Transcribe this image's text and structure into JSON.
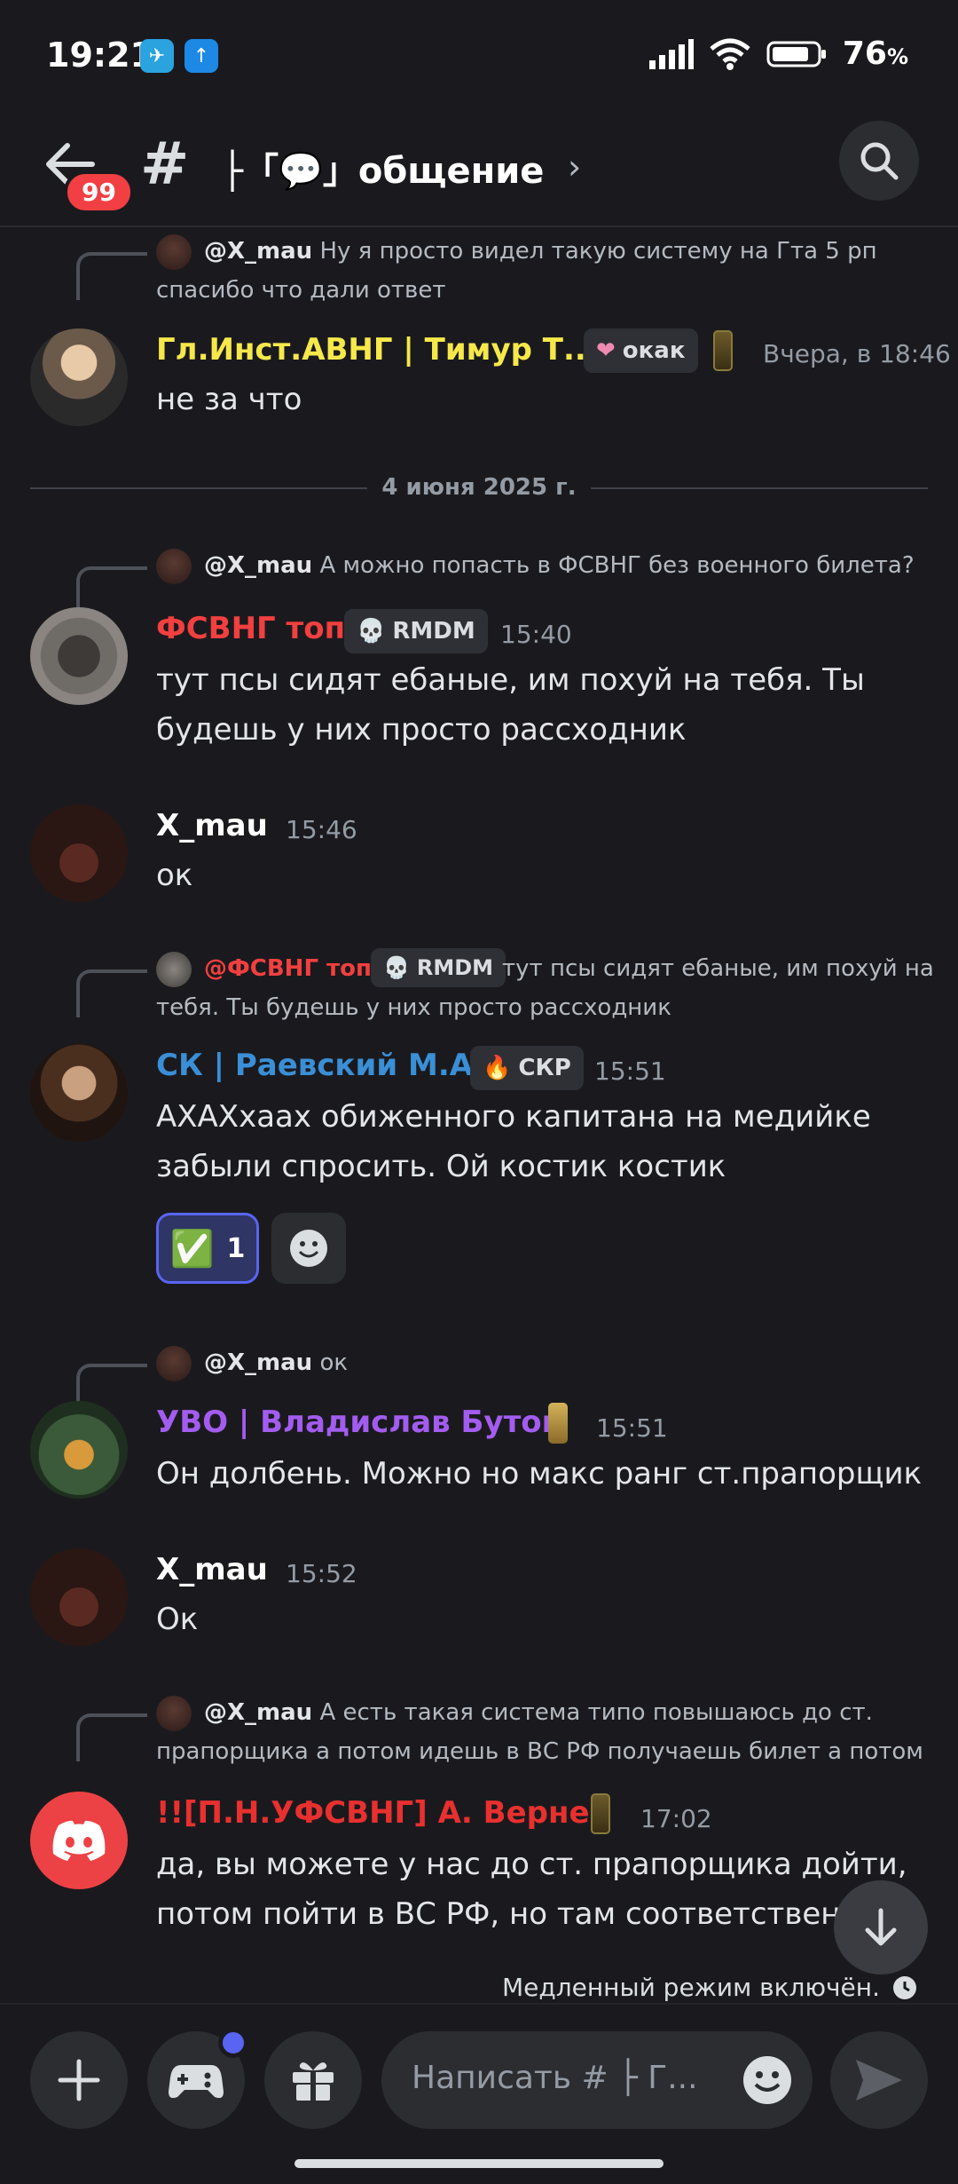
{
  "status_bar": {
    "time": "19:21",
    "battery_pct": "76",
    "battery_unit": "%"
  },
  "header": {
    "badge": "99",
    "channel_name": "├「💬」общение"
  },
  "messages": [
    {
      "reply_author": "@X_mau",
      "reply_line1": "Ну я просто видел такую систему на Гта 5 рп",
      "reply_line2": "спасибо что дали ответ",
      "author": "Гл.Инст.АВНГ | Тимур Т...",
      "author_color": "#f6e84a",
      "tag_label": "окак",
      "tag_emoji": "❤",
      "time": "Вчера, в 18:46",
      "lines": [
        "не за что"
      ]
    },
    {
      "reply_author": "@X_mau",
      "reply_line1": "А можно попасть в ФСВНГ без военного билета?",
      "author": "ФСВНГ топ",
      "author_color": "#f23f3f",
      "tag_label": "RMDM",
      "tag_emoji": "💀",
      "time": "15:40",
      "lines": [
        "тут псы сидят ебаные, им похуй на тебя. Ты",
        "будешь у них просто рассходник"
      ]
    },
    {
      "author": "X_mau",
      "author_color": "#ffffff",
      "time": "15:46",
      "lines": [
        "ок"
      ]
    },
    {
      "reply_author": "@ФСВНГ топ",
      "reply_tag": "RMDM",
      "reply_line1": "тут псы сидят ебаные, им похуй на",
      "reply_line2": "тебя. Ты будешь у них просто рассходник",
      "author": "СК | Раевский М.А.",
      "author_color": "#3a8fd6",
      "tag_label": "СКР",
      "tag_emoji": "🔥",
      "time": "15:51",
      "lines": [
        "АХАХхаах обиженного капитана на медийке",
        "забыли спросить. Ой костик костик"
      ],
      "reaction_emoji": "✅",
      "reaction_count": "1"
    },
    {
      "reply_author": "@X_mau",
      "reply_line1": "ок",
      "author": "УВО | Владислав Бутов",
      "author_color": "#a35cf0",
      "time": "15:51",
      "lines": [
        "Он долбень. Можно но макс ранг ст.прапорщик"
      ]
    },
    {
      "author": "X_mau",
      "author_color": "#ffffff",
      "time": "15:52",
      "lines": [
        "Ок"
      ]
    },
    {
      "reply_author": "@X_mau",
      "reply_line1": "А есть такая система типо повышаюсь до ст.",
      "reply_line2": "прапорщика а потом идешь в ВС РФ получаешь билет а потом",
      "author": "!![П.Н.УФСВНГ] А. Вернер",
      "author_color": "#e8302f",
      "time": "17:02",
      "lines": [
        "да, вы можете у нас до ст. прапорщика дойти,",
        "потом пойти в ВС РФ, но там соответственн"
      ]
    }
  ],
  "date_divider": "4 июня 2025 г.",
  "slow_mode": "Медленный режим включён.",
  "composer": {
    "placeholder": "Написать # ├ Г..."
  },
  "icons": [
    "back-arrow-icon",
    "hash-icon",
    "chevron-right-icon",
    "search-icon",
    "plus-icon",
    "gamepad-icon",
    "gift-icon",
    "emoji-icon",
    "send-icon",
    "arrow-down-icon",
    "clock-icon"
  ]
}
